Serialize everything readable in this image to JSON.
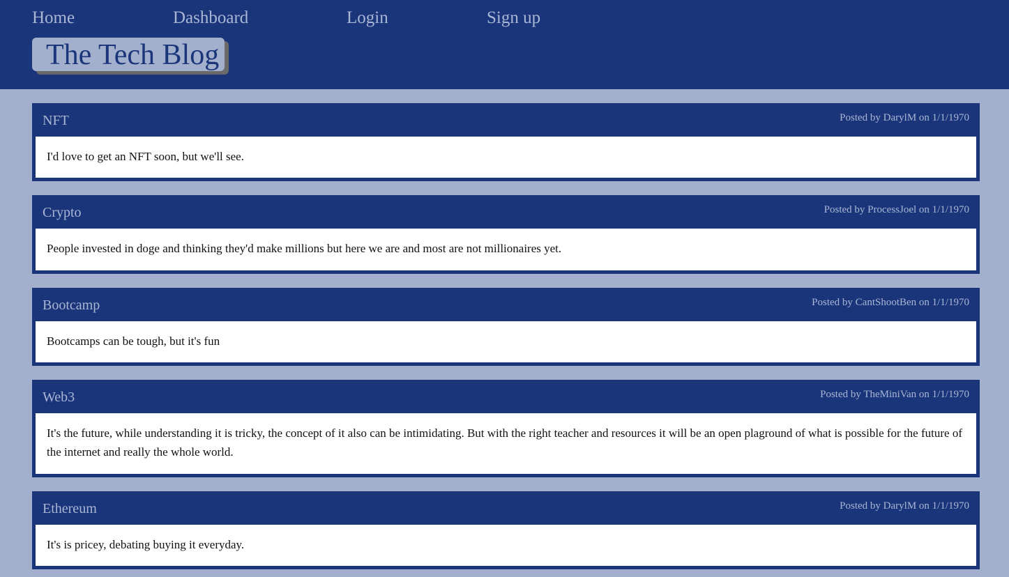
{
  "nav": {
    "home": "Home",
    "dashboard": "Dashboard",
    "login": "Login",
    "signup": "Sign up"
  },
  "brand": {
    "title": "The Tech Blog"
  },
  "posts": [
    {
      "title": "NFT",
      "meta": "Posted by DarylM on 1/1/1970",
      "body": "I'd love to get an NFT soon, but we'll see."
    },
    {
      "title": "Crypto",
      "meta": "Posted by ProcessJoel on 1/1/1970",
      "body": "People invested in doge and thinking they'd make millions but here we are and most are not millionaires yet."
    },
    {
      "title": "Bootcamp",
      "meta": "Posted by CantShootBen on 1/1/1970",
      "body": "Bootcamps can be tough, but it's fun"
    },
    {
      "title": "Web3",
      "meta": "Posted by TheMiniVan on 1/1/1970",
      "body": "It's the future, while understanding it is tricky, the concept of it also can be intimidating. But with the right teacher and resources it will be an open plaground of what is possible for the future of the internet and really the whole world."
    },
    {
      "title": "Ethereum",
      "meta": "Posted by DarylM on 1/1/1970",
      "body": "It's is pricey, debating buying it everyday."
    }
  ],
  "colors": {
    "header_bg": "#1b357b",
    "page_bg": "#a2b0cd",
    "nav_text": "#a9b6d4",
    "post_body_bg": "#ffffff"
  }
}
